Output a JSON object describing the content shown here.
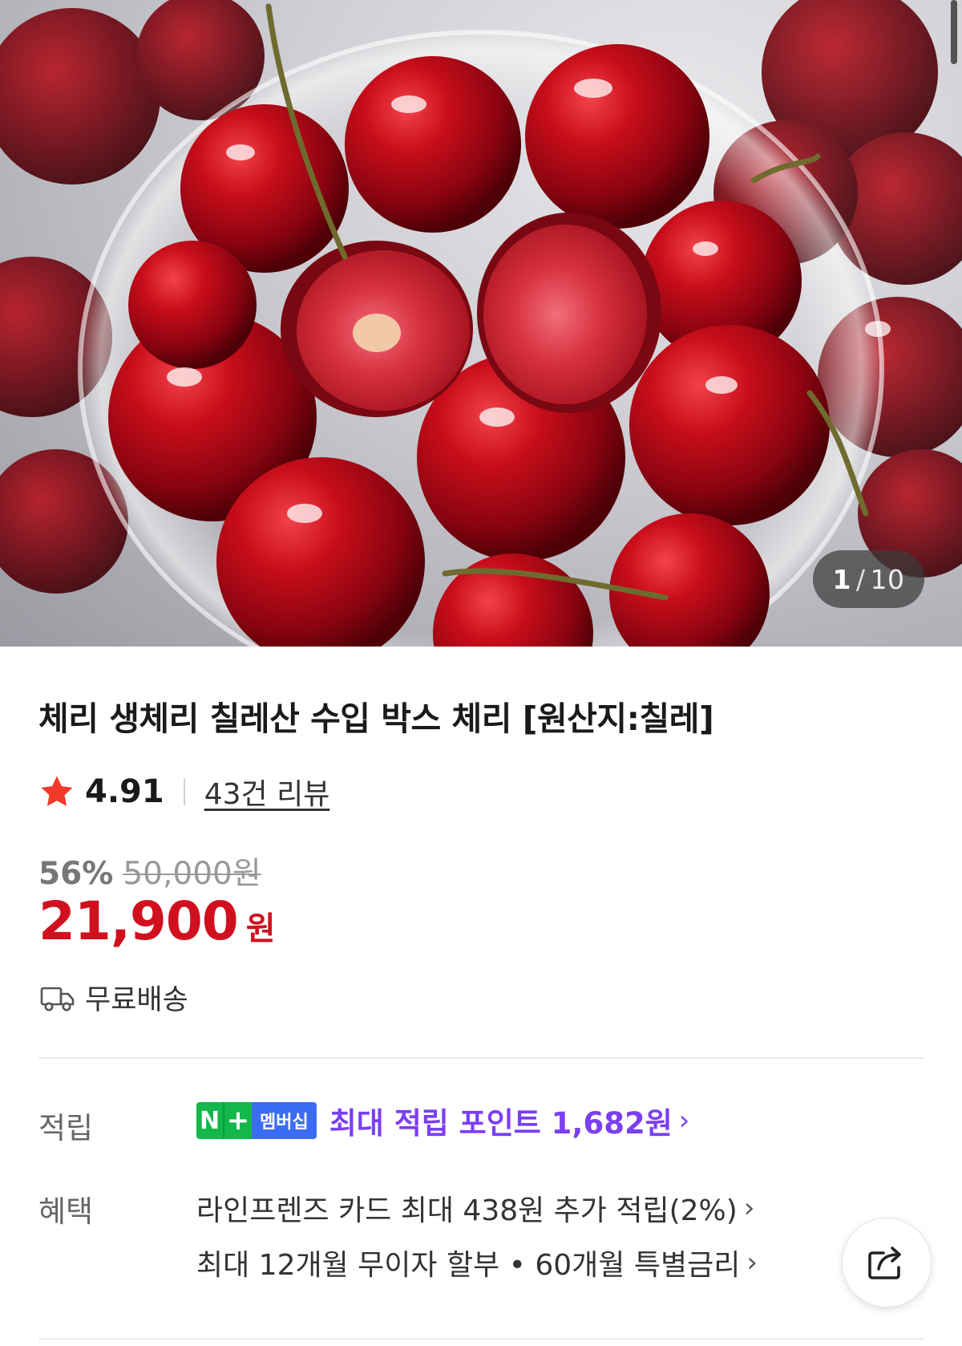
{
  "gallery": {
    "current": "1",
    "separator": "/",
    "total": "10"
  },
  "product": {
    "title": "체리 생체리 칠레산 수입 박스 체리 [원산지:칠레]",
    "rating": "4.91",
    "review_count": "43건 리뷰",
    "discount_rate": "56%",
    "original_price": "50,000원",
    "price": "21,900",
    "price_unit": "원",
    "shipping": "무료배송"
  },
  "points": {
    "label": "적립",
    "badge_n": "N",
    "badge_plus": "+",
    "badge_membership": "멤버십",
    "text": "최대 적립 포인트 1,682원",
    "chevron": "›"
  },
  "benefits": {
    "label": "혜택",
    "items": [
      {
        "text": "라인프렌즈 카드 최대 438원 추가 적립(2%)",
        "chevron": "›"
      },
      {
        "text": "최대 12개월 무이자 할부 • 60개월 특별금리",
        "chevron": "›"
      }
    ]
  },
  "icons": {
    "rating": "star-icon",
    "shipping": "delivery-truck-icon",
    "share": "share-icon"
  },
  "colors": {
    "price": "#d1101f",
    "star": "#f23a2b",
    "membership_text": "#7b3ff2",
    "badge_green": "#12b84c",
    "badge_blue": "#3b6cf5"
  }
}
